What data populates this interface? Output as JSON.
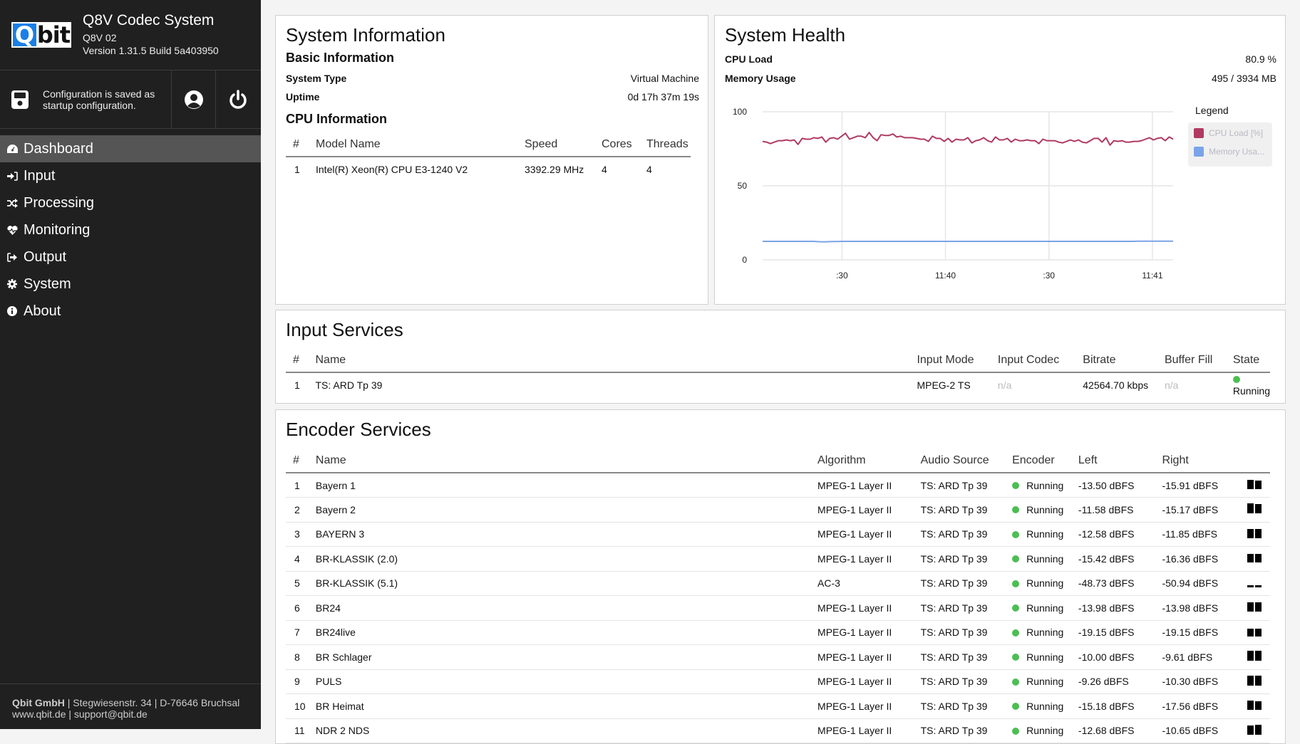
{
  "app": {
    "title": "Q8V Codec System",
    "device": "Q8V 02",
    "version": "Version 1.31.5 Build 5a403950",
    "logo": {
      "left": "Q",
      "right": "bit"
    }
  },
  "status": {
    "config_message": "Configuration is saved as startup configuration.",
    "icons": [
      "save-icon",
      "user-icon",
      "power-icon"
    ]
  },
  "sidebar": {
    "items": [
      {
        "label": "Dashboard",
        "icon": "dashboard-icon",
        "active": true
      },
      {
        "label": "Input",
        "icon": "sign-in-icon",
        "active": false
      },
      {
        "label": "Processing",
        "icon": "random-icon",
        "active": false
      },
      {
        "label": "Monitoring",
        "icon": "heartbeat-icon",
        "active": false
      },
      {
        "label": "Output",
        "icon": "sign-out-icon",
        "active": false
      },
      {
        "label": "System",
        "icon": "gear-icon",
        "active": false
      },
      {
        "label": "About",
        "icon": "info-icon",
        "active": false
      }
    ],
    "footer": {
      "company": "Qbit GmbH",
      "address": " | Stegwiesenstr. 34 | D-76646 Bruchsal",
      "contact": "www.qbit.de | support@qbit.de"
    }
  },
  "system_info": {
    "title": "System Information",
    "basic_title": "Basic Information",
    "system_type_label": "System Type",
    "system_type_value": "Virtual Machine",
    "uptime_label": "Uptime",
    "uptime_value": "0d 17h 37m 19s",
    "cpu_title": "CPU Information",
    "cpu_columns": [
      "#",
      "Model Name",
      "Speed",
      "Cores",
      "Threads"
    ],
    "cpu_rows": [
      [
        "1",
        "Intel(R) Xeon(R) CPU E3-1240 V2",
        "3392.29 MHz",
        "4",
        "4"
      ]
    ]
  },
  "system_health": {
    "title": "System Health",
    "cpu_label": "CPU Load",
    "cpu_value": "80.9 %",
    "memory_label": "Memory Usage",
    "memory_value": "495 / 3934 MB",
    "legend_title": "Legend",
    "colors": {
      "cpu": "#b03a62",
      "memory": "#7ba3e8"
    }
  },
  "chart_data": {
    "type": "line",
    "title": "",
    "xlabel": "",
    "ylabel": "",
    "ylim": [
      0,
      100
    ],
    "yticks": [
      0,
      50,
      100
    ],
    "x_range_seconds": [
      -23,
      96
    ],
    "xticks": [
      {
        "t": 0,
        "label": ":30"
      },
      {
        "t": 30,
        "label": "11:40"
      },
      {
        "t": 60,
        "label": ":30"
      },
      {
        "t": 90,
        "label": "11:41"
      }
    ],
    "grid": true,
    "legend": "right",
    "series": [
      {
        "name": "CPU Load [%]",
        "color": "#b03a62",
        "values": [
          80,
          79.5,
          78.5,
          79.5,
          80.5,
          80.5,
          81,
          80.5,
          81,
          78,
          82,
          81.5,
          81.5,
          82.5,
          82,
          83,
          79.5,
          82,
          82.5,
          81.5,
          83.5,
          85.5,
          81.5,
          82.5,
          83.5,
          83.5,
          82.5,
          86,
          82.5,
          80.5,
          84.5,
          84,
          84,
          85,
          83,
          83.5,
          82.5,
          82.5,
          82.5,
          82,
          81.5,
          81.5,
          80,
          83.5,
          82,
          82,
          80,
          82,
          79.5,
          81.5,
          81,
          81,
          82.5,
          79,
          80.5,
          81,
          82.5,
          80.5,
          79.5,
          83,
          81,
          81,
          82,
          79.5,
          81.5,
          80.5,
          80.5,
          81,
          80.5,
          80.5,
          78.5,
          81.5,
          80.5,
          80.5,
          80.5,
          79.5,
          79,
          80,
          81,
          80,
          81,
          79.5,
          79,
          80.5,
          82,
          82,
          79.5,
          82.5,
          77.5,
          80.5,
          80,
          80.5,
          79.5,
          79.5,
          80,
          80,
          80.5,
          81.5,
          82.5,
          81,
          82,
          82.5,
          80.5,
          83,
          81.5
        ]
      },
      {
        "name": "Memory Usa...",
        "color": "#7ba3e8",
        "values": [
          12.5,
          12.5,
          12.5,
          12.5,
          12.5,
          12.5,
          12.5,
          12.5,
          12.5,
          12.5,
          12.5,
          12.5,
          12.5,
          12.5,
          12.3,
          12.2,
          12.2,
          12.3,
          12.4,
          12.4,
          12.5,
          12.5,
          12.5,
          12.5,
          12.5,
          12.5,
          12.5,
          12.5,
          12.5,
          12.5,
          12.5,
          12.5,
          12.5,
          12.5,
          12.5,
          12.5,
          12.5,
          12.5,
          12.5,
          12.5,
          12.5,
          12.5,
          12.5,
          12.5,
          12.5,
          12.5,
          12.5,
          12.5,
          12.5,
          12.5,
          12.5,
          12.5,
          12.5,
          12.5,
          12.5,
          12.5,
          12.5,
          12.5,
          12.5,
          12.5,
          12.5,
          12.5,
          12.5,
          12.5,
          12.5,
          12.5,
          12.5,
          12.5,
          12.5,
          12.5,
          12.5,
          12.5,
          12.5,
          12.5,
          12.5,
          12.5,
          12.5,
          12.5,
          12.5,
          12.5,
          12.5,
          12.5,
          12.5,
          12.5,
          12.5,
          12.5,
          12.5,
          12.5,
          12.5,
          12.5,
          12.5,
          12.5,
          12.5,
          12.5,
          12.5,
          12.6,
          12.6,
          12.6,
          12.6,
          12.6,
          12.6,
          12.6,
          12.6,
          12.6,
          12.6
        ]
      }
    ]
  },
  "input_services": {
    "title": "Input Services",
    "columns": [
      "#",
      "Name",
      "Input Mode",
      "Input Codec",
      "Bitrate",
      "Buffer Fill",
      "State"
    ],
    "rows": [
      {
        "num": "1",
        "name": "TS: ARD Tp 39",
        "mode": "MPEG-2 TS",
        "codec": "n/a",
        "bitrate": "42564.70 kbps",
        "buffer": "n/a",
        "state": "Running"
      }
    ]
  },
  "encoder_services": {
    "title": "Encoder Services",
    "columns": [
      "#",
      "Name",
      "Algorithm",
      "Audio Source",
      "Encoder",
      "Left",
      "Right",
      ""
    ],
    "rows": [
      {
        "num": "1",
        "name": "Bayern 1",
        "algorithm": "MPEG-1 Layer II",
        "source": "TS: ARD Tp 39",
        "encoder": "Running",
        "left": "-13.50 dBFS",
        "right": "-15.91 dBFS",
        "left_db": -13.5,
        "right_db": -15.91
      },
      {
        "num": "2",
        "name": "Bayern 2",
        "algorithm": "MPEG-1 Layer II",
        "source": "TS: ARD Tp 39",
        "encoder": "Running",
        "left": "-11.58 dBFS",
        "right": "-15.17 dBFS",
        "left_db": -11.58,
        "right_db": -15.17
      },
      {
        "num": "3",
        "name": "BAYERN 3",
        "algorithm": "MPEG-1 Layer II",
        "source": "TS: ARD Tp 39",
        "encoder": "Running",
        "left": "-12.58 dBFS",
        "right": "-11.85 dBFS",
        "left_db": -12.58,
        "right_db": -11.85
      },
      {
        "num": "4",
        "name": "BR-KLASSIK (2.0)",
        "algorithm": "MPEG-1 Layer II",
        "source": "TS: ARD Tp 39",
        "encoder": "Running",
        "left": "-15.42 dBFS",
        "right": "-16.36 dBFS",
        "left_db": -15.42,
        "right_db": -16.36
      },
      {
        "num": "5",
        "name": "BR-KLASSIK (5.1)",
        "algorithm": "AC-3",
        "source": "TS: ARD Tp 39",
        "encoder": "Running",
        "left": "-48.73 dBFS",
        "right": "-50.94 dBFS",
        "left_db": -48.73,
        "right_db": -50.94
      },
      {
        "num": "6",
        "name": "BR24",
        "algorithm": "MPEG-1 Layer II",
        "source": "TS: ARD Tp 39",
        "encoder": "Running",
        "left": "-13.98 dBFS",
        "right": "-13.98 dBFS",
        "left_db": -13.98,
        "right_db": -13.98
      },
      {
        "num": "7",
        "name": "BR24live",
        "algorithm": "MPEG-1 Layer II",
        "source": "TS: ARD Tp 39",
        "encoder": "Running",
        "left": "-19.15 dBFS",
        "right": "-19.15 dBFS",
        "left_db": -19.15,
        "right_db": -19.15
      },
      {
        "num": "8",
        "name": "BR Schlager",
        "algorithm": "MPEG-1 Layer II",
        "source": "TS: ARD Tp 39",
        "encoder": "Running",
        "left": "-10.00 dBFS",
        "right": "-9.61 dBFS",
        "left_db": -10.0,
        "right_db": -9.61
      },
      {
        "num": "9",
        "name": "PULS",
        "algorithm": "MPEG-1 Layer II",
        "source": "TS: ARD Tp 39",
        "encoder": "Running",
        "left": "-9.26 dBFS",
        "right": "-10.30 dBFS",
        "left_db": -9.26,
        "right_db": -10.3
      },
      {
        "num": "10",
        "name": "BR Heimat",
        "algorithm": "MPEG-1 Layer II",
        "source": "TS: ARD Tp 39",
        "encoder": "Running",
        "left": "-15.18 dBFS",
        "right": "-17.56 dBFS",
        "left_db": -15.18,
        "right_db": -17.56
      },
      {
        "num": "11",
        "name": "NDR 2 NDS",
        "algorithm": "MPEG-1 Layer II",
        "source": "TS: ARD Tp 39",
        "encoder": "Running",
        "left": "-12.68 dBFS",
        "right": "-10.65 dBFS",
        "left_db": -12.68,
        "right_db": -10.65
      }
    ]
  },
  "colors": {
    "sidebar_bg": "#202020",
    "active_item_bg": "#555555",
    "running_dot": "#4cbe52",
    "logo_blue": "#1a7fe8"
  }
}
